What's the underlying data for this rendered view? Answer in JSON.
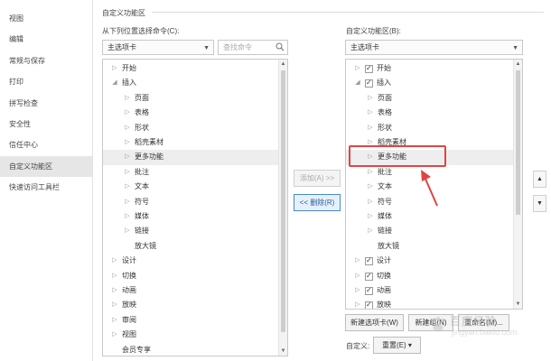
{
  "nav": {
    "items": [
      "视图",
      "编辑",
      "常规与保存",
      "打印",
      "拼写检查",
      "安全性",
      "信任中心",
      "自定义功能区",
      "快速访问工具栏"
    ],
    "active_index": 7
  },
  "heading": "自定义功能区",
  "left_panel": {
    "label": "从下列位置选择命令(C):",
    "select_value": "主选项卡",
    "search_placeholder": "查找命令",
    "tree": [
      {
        "label": "开始",
        "level": 0,
        "arrow": "right"
      },
      {
        "label": "插入",
        "level": 0,
        "arrow": "down"
      },
      {
        "label": "页面",
        "level": 1,
        "arrow": "right"
      },
      {
        "label": "表格",
        "level": 1,
        "arrow": "right"
      },
      {
        "label": "形状",
        "level": 1,
        "arrow": "right"
      },
      {
        "label": "稻壳素材",
        "level": 1,
        "arrow": "right"
      },
      {
        "label": "更多功能",
        "level": 1,
        "arrow": "right",
        "highlight": true
      },
      {
        "label": "批注",
        "level": 1,
        "arrow": "right"
      },
      {
        "label": "文本",
        "level": 1,
        "arrow": "right"
      },
      {
        "label": "符号",
        "level": 1,
        "arrow": "right"
      },
      {
        "label": "媒体",
        "level": 1,
        "arrow": "right"
      },
      {
        "label": "链接",
        "level": 1,
        "arrow": "right"
      },
      {
        "label": "放大镜",
        "level": 1,
        "arrow": "none"
      },
      {
        "label": "设计",
        "level": 0,
        "arrow": "right"
      },
      {
        "label": "切换",
        "level": 0,
        "arrow": "right"
      },
      {
        "label": "动画",
        "level": 0,
        "arrow": "right"
      },
      {
        "label": "放映",
        "level": 0,
        "arrow": "right"
      },
      {
        "label": "审阅",
        "level": 0,
        "arrow": "right"
      },
      {
        "label": "视图",
        "level": 0,
        "arrow": "right"
      },
      {
        "label": "会员专享",
        "level": 0,
        "arrow": "none"
      }
    ]
  },
  "middle": {
    "add_label": "添加(A) >>",
    "remove_label": "<< 删除(R)"
  },
  "right_panel": {
    "label": "自定义功能区(B):",
    "select_value": "主选项卡",
    "tree": [
      {
        "label": "开始",
        "level": 0,
        "arrow": "right",
        "checked": true
      },
      {
        "label": "插入",
        "level": 0,
        "arrow": "down",
        "checked": true
      },
      {
        "label": "页面",
        "level": 1,
        "arrow": "right"
      },
      {
        "label": "表格",
        "level": 1,
        "arrow": "right"
      },
      {
        "label": "形状",
        "level": 1,
        "arrow": "right"
      },
      {
        "label": "稻壳素材",
        "level": 1,
        "arrow": "right"
      },
      {
        "label": "更多功能",
        "level": 1,
        "arrow": "right",
        "highlight": true
      },
      {
        "label": "批注",
        "level": 1,
        "arrow": "right"
      },
      {
        "label": "文本",
        "level": 1,
        "arrow": "right"
      },
      {
        "label": "符号",
        "level": 1,
        "arrow": "right"
      },
      {
        "label": "媒体",
        "level": 1,
        "arrow": "right"
      },
      {
        "label": "链接",
        "level": 1,
        "arrow": "right"
      },
      {
        "label": "放大镜",
        "level": 1,
        "arrow": "none"
      },
      {
        "label": "设计",
        "level": 0,
        "arrow": "right",
        "checked": true
      },
      {
        "label": "切换",
        "level": 0,
        "arrow": "right",
        "checked": true
      },
      {
        "label": "动画",
        "level": 0,
        "arrow": "right",
        "checked": true
      },
      {
        "label": "放映",
        "level": 0,
        "arrow": "right",
        "checked": true
      }
    ],
    "new_tab_label": "新建选项卡(W)",
    "new_group_label": "新建组(N)",
    "rename_label": "重命名(M)...",
    "customize_label": "自定义:",
    "reset_label": "重置(E) ▾"
  },
  "side_buttons": {
    "up": "▲",
    "down": "▼"
  },
  "watermark": {
    "text": "百度经验",
    "sub": "jingyan.baidu.com"
  },
  "colors": {
    "annotation_red": "#e04545",
    "accent_blue": "#4b88c9"
  }
}
